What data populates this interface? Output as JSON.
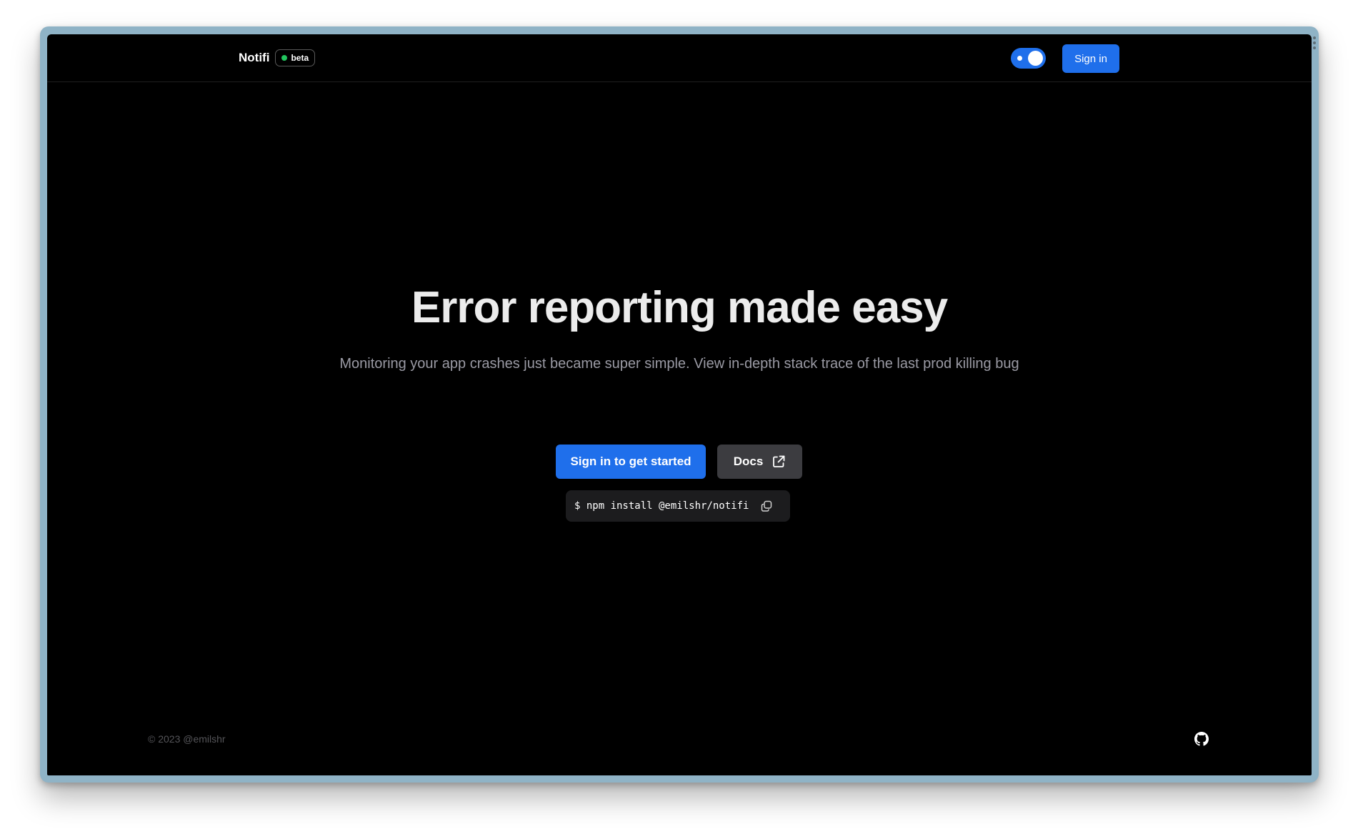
{
  "header": {
    "brand": "Notifi",
    "badge": "beta",
    "theme_toggle_on": true,
    "signin_label": "Sign in"
  },
  "hero": {
    "title": "Error reporting made easy",
    "subtitle": "Monitoring your app crashes just became super simple. View in-depth stack trace of the last prod killing bug",
    "primary_cta": "Sign in to get started",
    "docs_cta": "Docs",
    "install_command": "$ npm install @emilshr/notifi"
  },
  "footer": {
    "copyright": "© 2023 @emilshr"
  },
  "icons": {
    "docs": "external-link-icon",
    "copy": "copy-icon",
    "github": "github-icon",
    "badge_dot": "status-dot-icon"
  },
  "colors": {
    "background": "#000000",
    "accent": "#1f6feb",
    "docs_button": "#3c3c40",
    "status_dot": "#22c55e",
    "frame": "#8fb3c6"
  }
}
